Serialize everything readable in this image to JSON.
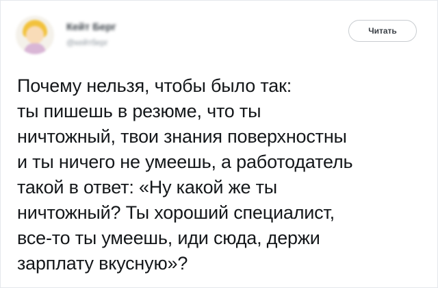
{
  "author": {
    "name": "Кейт Берг",
    "handle": "@кейтберг"
  },
  "follow_button": {
    "label": "Читать"
  },
  "tweet": {
    "lines": [
      "Почему нельзя, чтобы было так:",
      "ты пишешь в резюме, что ты",
      "ничтожный, твои знания поверхностны",
      "и ты ничего не умеешь, а работодатель",
      "такой в ответ: «Ну какой же ты",
      "ничтожный? Ты хороший специалист,",
      "все-то ты умеешь, иди сюда, держи",
      "зарплату вкусную»?"
    ]
  },
  "colors": {
    "text": "#14171a",
    "border": "#e4e8ec",
    "button_border": "#c8ccd0",
    "avatar_hair": "#f2c23c"
  }
}
